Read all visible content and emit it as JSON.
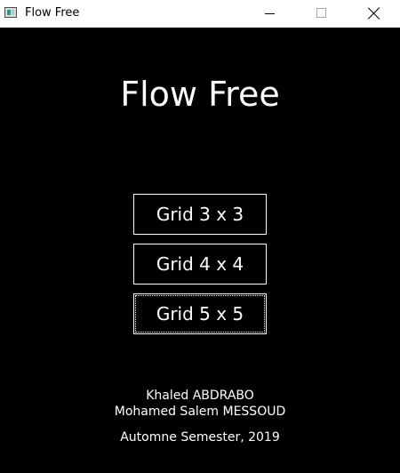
{
  "window": {
    "title": "Flow Free",
    "icon": "app-window-icon",
    "controls": [
      "minimize-icon",
      "maximize-icon",
      "close-icon"
    ]
  },
  "menu": {
    "title": "Flow Free",
    "buttons": [
      {
        "label": "Grid 3 x 3",
        "focused": false
      },
      {
        "label": "Grid 4 x 4",
        "focused": false
      },
      {
        "label": "Grid 5 x 5",
        "focused": true
      }
    ]
  },
  "credits": {
    "authors": [
      "Khaled ABDRABO",
      "Mohamed Salem MESSOUD"
    ],
    "semester": "Automne Semester, 2019"
  },
  "colors": {
    "background": "#000000",
    "foreground": "#ffffff",
    "titlebar": "#ffffff"
  }
}
